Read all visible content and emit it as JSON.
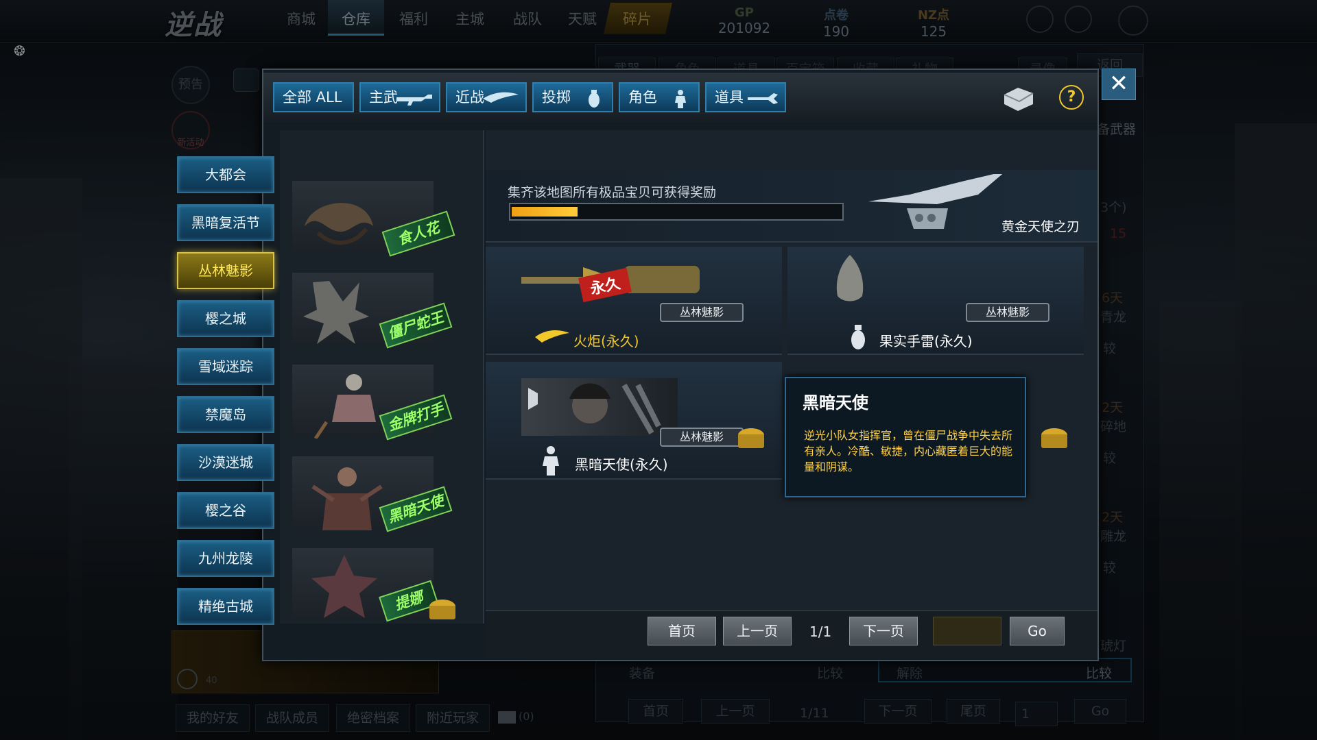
{
  "top_nav": {
    "items": [
      "商城",
      "仓库",
      "福利",
      "主城",
      "战队",
      "天赋",
      "碎片"
    ],
    "currencies": [
      {
        "label": "GP",
        "value": "201092"
      },
      {
        "label": "点卷",
        "value": "190"
      },
      {
        "label": "NZ点",
        "value": "125"
      }
    ]
  },
  "background": {
    "tabs": [
      "武器",
      "角色",
      "道具",
      "百宝箱",
      "收藏",
      "礼物"
    ],
    "record_button": "录像",
    "back_button": "返回",
    "equip_label": "装备武器",
    "left_circles": [
      "预告",
      "新活动"
    ],
    "right_ghost_texts": [
      "3个)",
      "15",
      "6天",
      "青龙",
      "较",
      "2天",
      "碎地",
      "较",
      "2天",
      "雕龙",
      "较",
      "琥灯"
    ],
    "bottom_bar": [
      "装备",
      "比较",
      "解除",
      "比较"
    ],
    "bottom_pager": {
      "first": "首页",
      "prev": "上一页",
      "page": "1/11",
      "next": "下一页",
      "last": "尾页",
      "input": "1",
      "go": "Go"
    },
    "friends": [
      "我的好友",
      "战队成员",
      "绝密档案",
      "附近玩家"
    ],
    "mail_count": "(0)",
    "player_level": "40"
  },
  "filter_bar": {
    "buttons": [
      "全部 ALL",
      "主武",
      "近战",
      "投掷",
      "角色",
      "道具"
    ]
  },
  "maps": [
    "大都会",
    "黑暗复活节",
    "丛林魅影",
    "樱之城",
    "雪域迷踪",
    "禁魔岛",
    "沙漠迷城",
    "樱之谷",
    "九州龙陵",
    "精绝古城"
  ],
  "active_map": "丛林魅影",
  "bosses": [
    "食人花",
    "僵尸蛇王",
    "金牌打手",
    "黑暗天使",
    "提娜"
  ],
  "reward": {
    "description": "集齐该地图所有极品宝贝可获得奖励",
    "progress": 0.2,
    "item_name": "黄金天使之刃"
  },
  "items": [
    {
      "name": "火炬(永久)",
      "map": "丛林魅影",
      "name_color": "#f2c82a",
      "stamp": "永久"
    },
    {
      "name": "果实手雷(永久)",
      "map": "丛林魅影",
      "name_color": "#ffffff"
    },
    {
      "name": "黑暗天使(永久)",
      "map": "丛林魅影",
      "name_color": "#ffffff"
    }
  ],
  "tooltip": {
    "title": "黑暗天使",
    "description": "逆光小队女指挥官，曾在僵尸战争中失去所有亲人。冷酷、敏捷，内心藏匿着巨大的能量和阴谋。"
  },
  "pager": {
    "first": "首页",
    "prev": "上一页",
    "page": "1/1",
    "next": "下一页",
    "go": "Go"
  },
  "colors": {
    "accent": "#2e7fae",
    "active": "#d9c24a",
    "progress": "#f0a014"
  }
}
